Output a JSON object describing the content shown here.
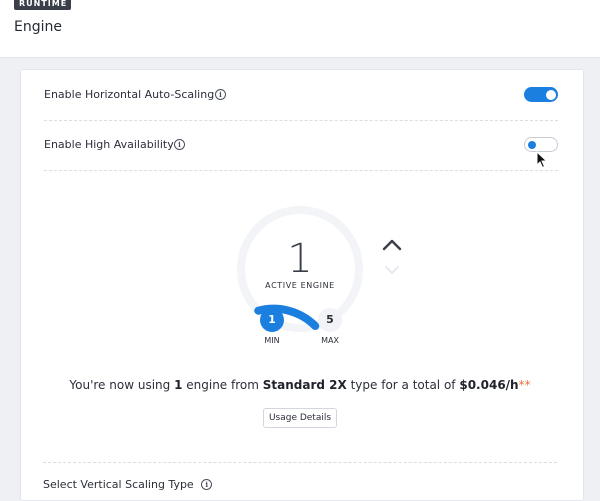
{
  "header": {
    "badge": "RUNTIME",
    "title": "Engine"
  },
  "settings": {
    "autoscaling": {
      "label": "Enable Horizontal Auto-Scaling",
      "enabled": true
    },
    "high_availability": {
      "label": "Enable High Availability",
      "enabled": false
    }
  },
  "gauge": {
    "active_count": "1",
    "active_label": "ACTIVE ENGINE",
    "min_value": "1",
    "min_label": "MIN",
    "max_value": "5",
    "max_label": "MAX",
    "fill_fraction": 0.2,
    "accent_color": "#1b7fe0"
  },
  "summary": {
    "prefix": "You're now using",
    "count": "1",
    "middle1": "engine from",
    "engine_type": "Standard 2X",
    "middle2": "type for a total of",
    "price": "$0.046/h",
    "stars": "**"
  },
  "usage_button": "Usage Details",
  "vertical_scaling": {
    "label": "Select Vertical Scaling Type"
  },
  "icons": {
    "info": "info-icon",
    "increase": "chevron-up-icon",
    "decrease": "chevron-down-icon",
    "cursor": "mouse-pointer-icon"
  }
}
